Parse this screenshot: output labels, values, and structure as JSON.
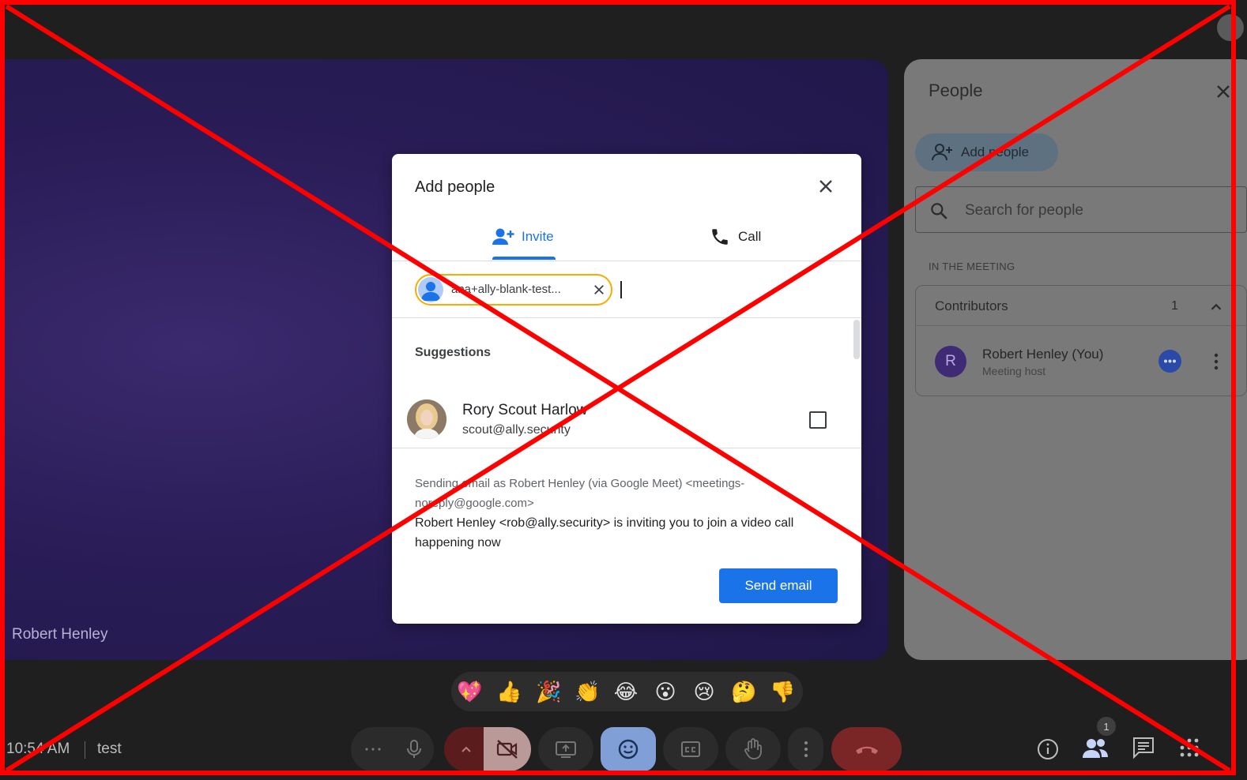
{
  "stage": {
    "participant_name": "Robert Henley"
  },
  "people_panel": {
    "title": "People",
    "add_people_label": "Add people",
    "search_placeholder": "Search for people",
    "section_label": "IN THE MEETING",
    "group_label": "Contributors",
    "group_count": "1",
    "participants": [
      {
        "initial": "R",
        "name": "Robert Henley (You)",
        "role": "Meeting host"
      }
    ]
  },
  "dialog": {
    "title": "Add people",
    "tabs": [
      {
        "label": "Invite",
        "active": true
      },
      {
        "label": "Call",
        "active": false
      }
    ],
    "chip_text": "ana+ally-blank-test...",
    "suggestions_title": "Suggestions",
    "suggestions": [
      {
        "name": "Rory Scout Harlow",
        "email": "scout@ally.security",
        "checked": false
      }
    ],
    "sending_note": "Sending email as Robert Henley (via Google Meet) <meetings-noreply@google.com>",
    "invite_message": "Robert Henley <rob@ally.security> is inviting you to join a video call happening now",
    "send_button": "Send email"
  },
  "reactions": [
    "💖",
    "👍",
    "🎉",
    "👏",
    "😂",
    "😮",
    "😢",
    "🤔",
    "👎"
  ],
  "bottom_bar": {
    "time": "10:54 AM",
    "meeting_name": "test",
    "people_badge": "1"
  },
  "colors": {
    "accent": "#1a73e8",
    "chip_border": "#f9ab00",
    "stage": "#2a1d58",
    "overlay": "#ff0000"
  }
}
